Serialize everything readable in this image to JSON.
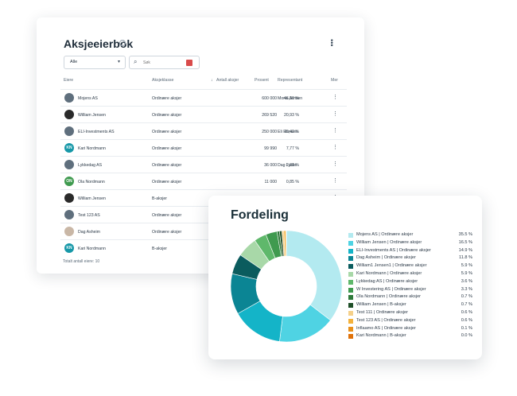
{
  "shareholder_book": {
    "title": "Aksjeeierbok",
    "filter": {
      "value": "Alle"
    },
    "search": {
      "placeholder": "Søk"
    },
    "columns": {
      "owner": "Eiere",
      "share_class": "Aksjeklasse",
      "shares": "Antall aksjer",
      "percent": "Prosent",
      "representative": "Representant",
      "more": "Mer"
    },
    "rows": [
      {
        "avatar": "org",
        "initials": "",
        "name": "Mojens AS",
        "class": "Ordinære aksjer",
        "shares": "600 000",
        "percent": "46,60 %",
        "rep": "Mona Jensen"
      },
      {
        "avatar": "dark",
        "initials": "",
        "name": "William Jensen",
        "class": "Ordinære aksjer",
        "shares": "269 520",
        "percent": "20,93 %",
        "rep": ""
      },
      {
        "avatar": "org",
        "initials": "",
        "name": "ELI-Investments AS",
        "class": "Ordinære aksjer",
        "shares": "250 000",
        "percent": "19,42 %",
        "rep": "Eli Hansen"
      },
      {
        "avatar": "teal",
        "initials": "KN",
        "name": "Kari Nordmann",
        "class": "Ordinære aksjer",
        "shares": "99 990",
        "percent": "7,77 %",
        "rep": ""
      },
      {
        "avatar": "org",
        "initials": "",
        "name": "Lykkedag AS",
        "class": "Ordinære aksjer",
        "shares": "36 000",
        "percent": "2,80 %",
        "rep": "Dag Lycke"
      },
      {
        "avatar": "green",
        "initials": "ON",
        "name": "Ola Nordmann",
        "class": "Ordinære aksjer",
        "shares": "11 000",
        "percent": "0,85 %",
        "rep": ""
      },
      {
        "avatar": "dark",
        "initials": "",
        "name": "William Jensen",
        "class": "B-aksjer",
        "shares": "",
        "percent": "",
        "rep": ""
      },
      {
        "avatar": "org",
        "initials": "",
        "name": "Test 123 AS",
        "class": "Ordinære aksjer",
        "shares": "",
        "percent": "",
        "rep": ""
      },
      {
        "avatar": "photo",
        "initials": "",
        "name": "Dag Asheim",
        "class": "Ordinære aksjer",
        "shares": "",
        "percent": "",
        "rep": ""
      },
      {
        "avatar": "teal",
        "initials": "KN",
        "name": "Kari Nordmann",
        "class": "B-aksjer",
        "shares": "",
        "percent": "",
        "rep": ""
      }
    ],
    "total": "Totalt antall eiere: 10"
  },
  "distribution": {
    "title": "Fordeling",
    "chart_data": {
      "type": "pie",
      "title": "Fordeling",
      "categories": [
        "Mojens AS | Ordinære aksjer",
        "William Jensen | Ordinære aksjer",
        "ELI-Investments AS | Ordinære aksjer",
        "Dag Asheim | Ordinære aksjer",
        "William1 Jensen1 | Ordinære aksjer",
        "Kari Nordmann | Ordinære aksjer",
        "Lykkedag AS | Ordinære aksjer",
        "W Investering AS | Ordinære aksjer",
        "Ola Nordmann | Ordinære aksjer",
        "William Jensen | B-aksjer",
        "Test 111 | Ordinære aksjer",
        "Test 123 AS | Ordinære aksjer",
        "Inflaamo AS | Ordinære aksjer",
        "Kari Nordmann | B-aksjer"
      ],
      "values": [
        35.5,
        16.5,
        14.9,
        11.8,
        5.9,
        5.9,
        3.6,
        3.3,
        0.7,
        0.7,
        0.6,
        0.6,
        0.1,
        0.0
      ],
      "labels": [
        "35.5 %",
        "16.5 %",
        "14.9 %",
        "11.8 %",
        "5.9 %",
        "5.9 %",
        "3.6 %",
        "3.3 %",
        "0.7 %",
        "0.7 %",
        "0.6 %",
        "0.6 %",
        "0.1 %",
        "0.0 %"
      ],
      "colors": [
        "#b3eaf0",
        "#4fd3e3",
        "#14b4c8",
        "#0b8594",
        "#0b5c5e",
        "#a8d8a8",
        "#5fb86b",
        "#3f9a4f",
        "#2f7a3a",
        "#1f4f28",
        "#f5d08a",
        "#f4b23c",
        "#e8901a",
        "#e0720a"
      ],
      "legend": "right",
      "donut": true
    }
  }
}
